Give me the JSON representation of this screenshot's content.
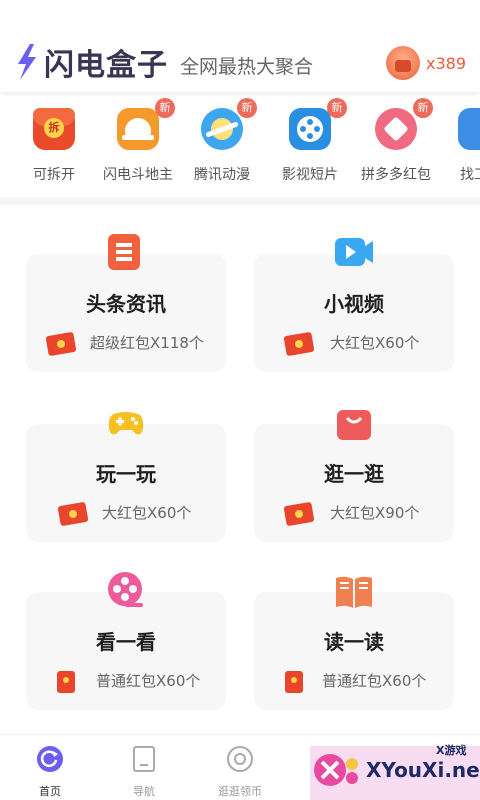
{
  "header": {
    "logo_text": "闪电盒子",
    "slogan": "全网最热大聚合",
    "coin_count": "x389"
  },
  "quick_nav": {
    "new_label": "新",
    "items": [
      {
        "label": "可拆开",
        "icon": "red-envelope-icon",
        "is_new": false
      },
      {
        "label": "闪电斗地主",
        "icon": "helmet-icon",
        "is_new": true
      },
      {
        "label": "腾讯动漫",
        "icon": "planet-icon",
        "is_new": true
      },
      {
        "label": "影视短片",
        "icon": "film-reel-icon",
        "is_new": true
      },
      {
        "label": "拼多多红包",
        "icon": "heart-gift-icon",
        "is_new": true
      },
      {
        "label": "找工",
        "icon": "briefcase-icon",
        "is_new": false
      }
    ],
    "envelope_glyph": "拆"
  },
  "cards": [
    {
      "title": "头条资讯",
      "reward": "超级红包X118个",
      "icon": "news-icon",
      "color": "#f0623f"
    },
    {
      "title": "小视频",
      "reward": "大红包X60个",
      "icon": "video-icon",
      "color": "#3aa8f0"
    },
    {
      "title": "玩一玩",
      "reward": "大红包X60个",
      "icon": "gamepad-icon",
      "color": "#f5c020"
    },
    {
      "title": "逛一逛",
      "reward": "大红包X90个",
      "icon": "shopping-bag-icon",
      "color": "#ef5a5a"
    },
    {
      "title": "看一看",
      "reward": "普通红包X60个",
      "icon": "film-reel-icon",
      "color": "#ef5a9a"
    },
    {
      "title": "读一读",
      "reward": "普通红包X60个",
      "icon": "book-icon",
      "color": "#f08050"
    }
  ],
  "bottom_nav": [
    {
      "label": "首页",
      "icon": "home-refresh-icon",
      "active": true
    },
    {
      "label": "导航",
      "icon": "navigation-icon",
      "active": false
    },
    {
      "label": "逛逛领币",
      "icon": "eye-icon",
      "active": false
    }
  ],
  "watermark": {
    "text": "XYouXi.net",
    "small": "X游戏"
  },
  "colors": {
    "accent": "#6b5ff0",
    "coin": "#ee5a3b",
    "badge": "#ee6a5a"
  }
}
